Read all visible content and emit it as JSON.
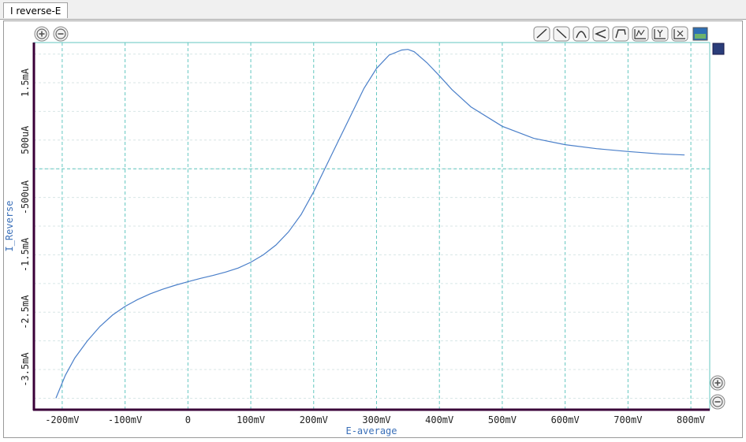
{
  "window": {
    "tab_label": "I reverse-E"
  },
  "toolbar": {
    "top_left": [
      "zoom-in",
      "zoom-out"
    ],
    "top_right": [
      "slope-up",
      "slope-down",
      "peak",
      "reverse",
      "step",
      "auto-scale-xy",
      "auto-scale-y",
      "auto-scale-x",
      "chart-view"
    ],
    "right_side": [
      "zoom-in",
      "zoom-out"
    ]
  },
  "colors": {
    "curve": "#4a7fc9",
    "grid": "#63c7c0",
    "axis": "#3a0038",
    "axis_label": "#3a6fb8"
  },
  "chart_data": {
    "type": "line",
    "xlabel": "E-average",
    "ylabel": "I_Reverse",
    "x_ticks": [
      "-200mV",
      "-100mV",
      "0",
      "100mV",
      "200mV",
      "300mV",
      "400mV",
      "500mV",
      "600mV",
      "700mV",
      "800mV"
    ],
    "y_ticks": [
      "1.5mA",
      "500uA",
      "-500uA",
      "-1.5mA",
      "-2.5mA",
      "-3.5mA"
    ],
    "xlim": [
      -245,
      830
    ],
    "ylim": [
      -4.2,
      2.2
    ],
    "grid": true,
    "series": [
      {
        "x": [
          -210,
          -195,
          -180,
          -160,
          -140,
          -120,
          -100,
          -80,
          -60,
          -40,
          -20,
          0,
          20,
          40,
          60,
          80,
          100,
          120,
          140,
          160,
          180,
          200,
          220,
          240,
          260,
          280,
          300,
          320,
          340,
          350,
          360,
          380,
          400,
          420,
          450,
          500,
          550,
          600,
          650,
          700,
          750,
          790
        ],
        "y": [
          -4.0,
          -3.6,
          -3.3,
          -3.0,
          -2.75,
          -2.55,
          -2.4,
          -2.28,
          -2.18,
          -2.1,
          -2.03,
          -1.97,
          -1.91,
          -1.86,
          -1.8,
          -1.73,
          -1.63,
          -1.5,
          -1.33,
          -1.1,
          -0.8,
          -0.4,
          0.05,
          0.5,
          0.95,
          1.4,
          1.75,
          1.98,
          2.07,
          2.08,
          2.04,
          1.85,
          1.62,
          1.38,
          1.08,
          0.74,
          0.53,
          0.42,
          0.35,
          0.3,
          0.26,
          0.24
        ]
      }
    ]
  }
}
